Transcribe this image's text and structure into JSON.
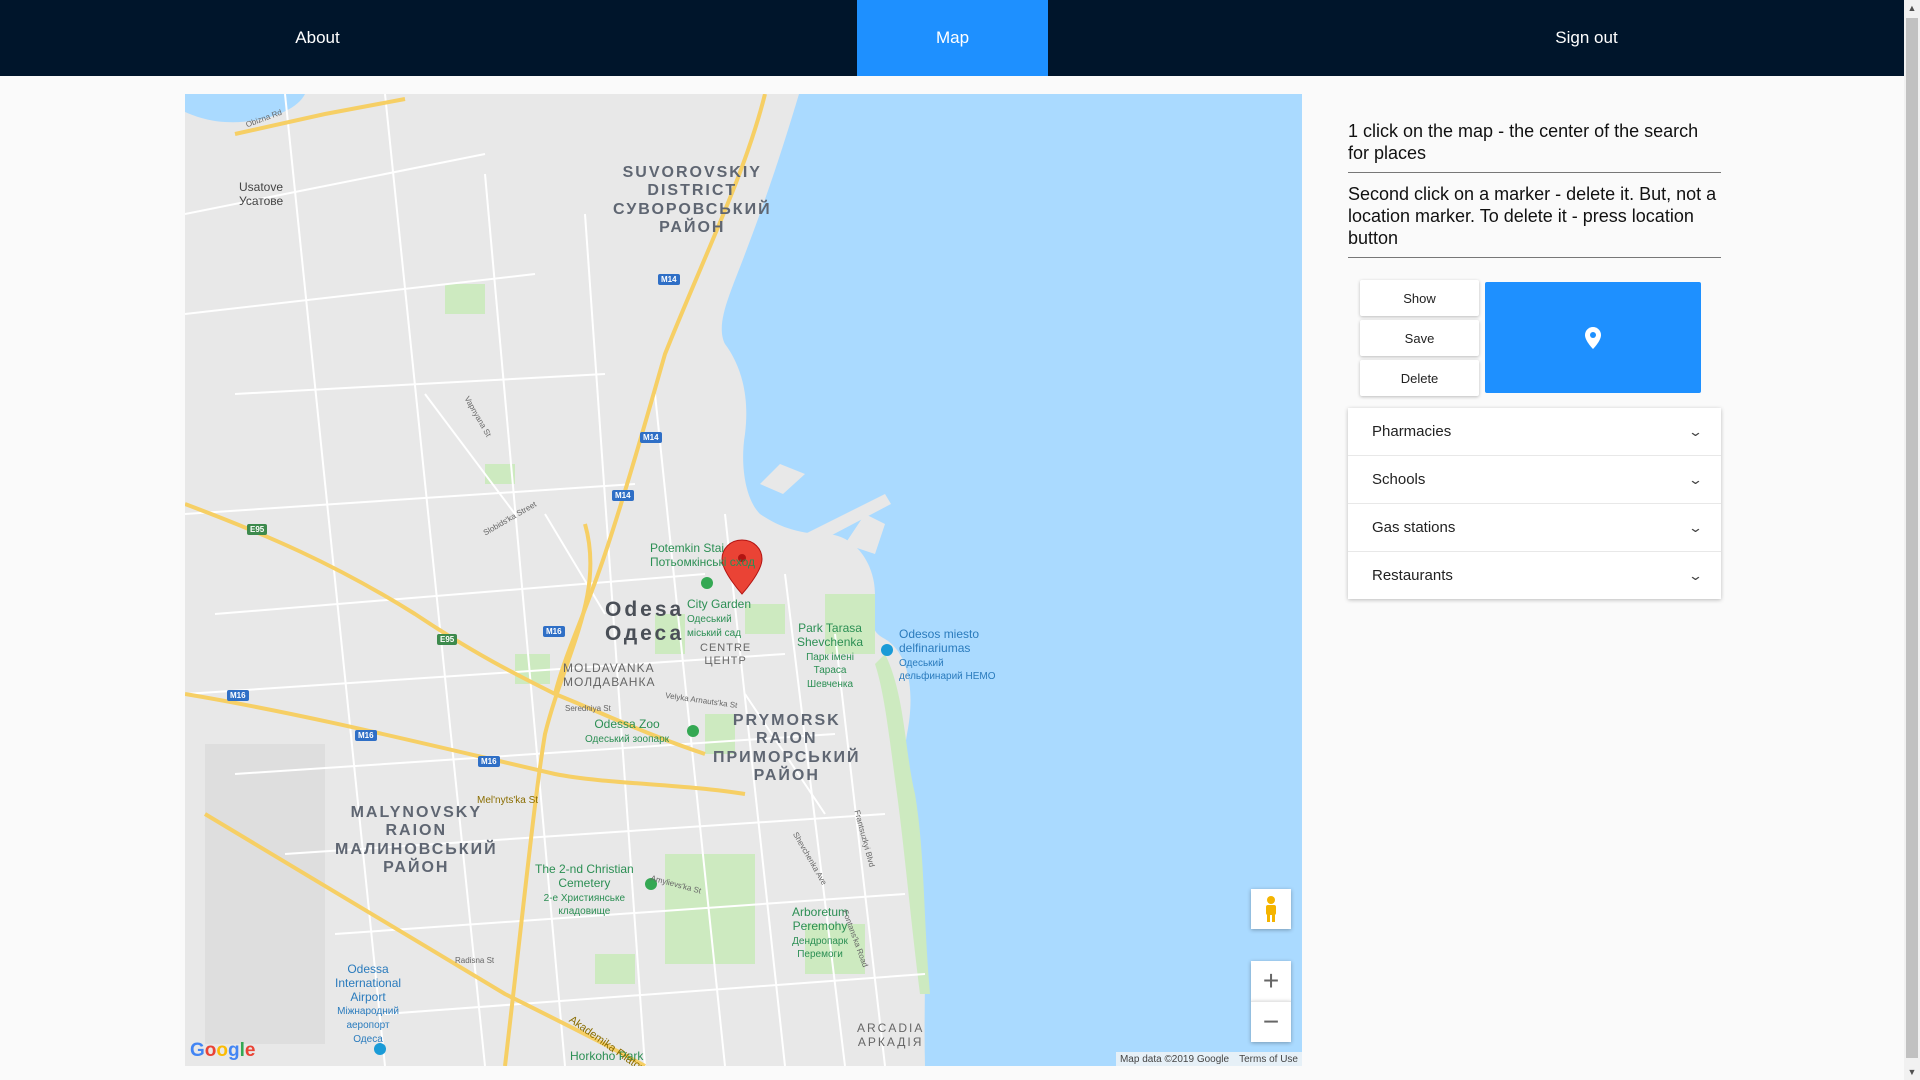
{
  "nav": {
    "about": "About",
    "map": "Map",
    "sign_out": "Sign out",
    "active": "Map",
    "bg_color": "#00152b",
    "active_color": "#1e90ff"
  },
  "map": {
    "labels": {
      "suvorovskiy_1": "SUVOROVSKIY",
      "suvorovskiy_2": "DISTRICT",
      "suvorovskiy_3": "СУВОРОВСЬКИЙ",
      "suvorovskiy_4": "РАЙОН",
      "usatove_1": "Usatove",
      "usatove_2": "Усатове",
      "odesa_1": "Odesa",
      "odesa_2": "Одеса",
      "centre_1": "CENTRE",
      "centre_2": "ЦЕНТР",
      "moldavanka_1": "MOLDAVANKA",
      "moldavanka_2": "МОЛДАВАНКА",
      "prymorsk_1": "PRYMORSK",
      "prymorsk_2": "RAION",
      "prymorsk_3": "ПРИМОРСЬКИЙ",
      "prymorsk_4": "РАЙОН",
      "malynovsky_1": "MALYNOVSKY",
      "malynovsky_2": "RAION",
      "malynovsky_3": "МАЛИНОВСЬКИЙ",
      "malynovsky_4": "РАЙОН",
      "arcadia_1": "ARCADIA",
      "arcadia_2": "АРКАДІЯ",
      "potemkin_1": "Potemkin Stai",
      "potemkin_2": "Потьомкінські сход",
      "city_garden_1": "City Garden",
      "city_garden_2": "Одеський",
      "city_garden_3": "міський сад",
      "park_tarasa_1": "Park Tarasa",
      "park_tarasa_2": "Shevchenka",
      "park_tarasa_3": "Парк імені",
      "park_tarasa_4": "Тараса",
      "park_tarasa_5": "Шевченка",
      "dolphinarium_1": "Odesos miesto",
      "dolphinarium_2": "delfinariumas",
      "dolphinarium_3": "Одеський",
      "dolphinarium_4": "дельфинарий НЕМО",
      "zoo_1": "Odessa Zoo",
      "zoo_2": "Одеський зоопарк",
      "cemetery_1": "The 2-nd Christian",
      "cemetery_2": "Cemetery",
      "cemetery_3": "2-е Християнське",
      "cemetery_4": "кладовище",
      "arboretum_1": "Arboretum",
      "arboretum_2": "Peremohy",
      "arboretum_3": "Дендропарк",
      "arboretum_4": "Перемоги",
      "airport_1": "Odessa",
      "airport_2": "International",
      "airport_3": "Airport",
      "airport_4": "Міжнародний",
      "airport_5": "аеропорт",
      "airport_6": "Одеса",
      "horkoho_park": "Horkoho Park",
      "akademika_filatova": "Akademika Filatova St",
      "melnytska": "Mel'nyts'ka St",
      "obizna_rd": "Obizna Rd",
      "velyka_arnautska": "Velyka Arnauts'ka St",
      "sredniya": "Seredniya St",
      "radisna": "Radisna St",
      "vapnyana": "Vapnyana St",
      "slobidska": "Slobids'ka Street",
      "fontanska": "Fontans'ka Road",
      "frantsuzky": "Frantsuzkyi Blvd",
      "shevchenka_ave": "Shevchenka Ave",
      "amyliuna": "Amylievs'ka St"
    },
    "shields": [
      "M14",
      "M14",
      "M14",
      "E95",
      "E95",
      "M16",
      "M16",
      "M16",
      "M16"
    ],
    "google_logo": "Google",
    "map_data": "Map data ©2019 Google",
    "terms": "Terms of Use",
    "zoom_in": "+",
    "zoom_out": "−"
  },
  "panel": {
    "hint1": "1 click on the map - the center of the search for places",
    "hint2": "Second click on a marker - delete it. But, not a location marker. To delete it - press location button",
    "show": "Show",
    "save": "Save",
    "delete": "Delete",
    "location_icon": "location-pin-icon",
    "categories": [
      "Pharmacies",
      "Schools",
      "Gas stations",
      "Restaurants"
    ]
  }
}
